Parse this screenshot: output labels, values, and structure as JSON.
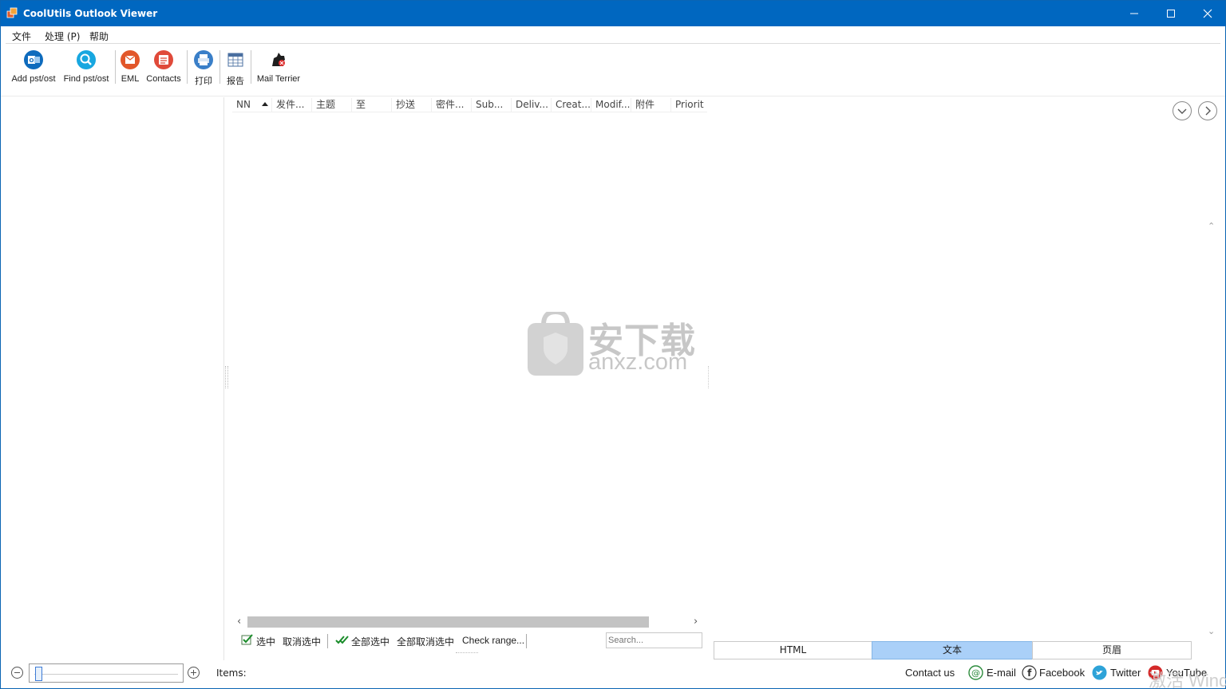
{
  "window": {
    "title": "CoolUtils Outlook Viewer"
  },
  "menu": {
    "items": [
      "文件",
      "处理 (P)",
      "帮助"
    ]
  },
  "toolbar": {
    "buttons": [
      {
        "label": "Add pst/ost",
        "icon": "outlook-icon"
      },
      {
        "label": "Find pst/ost",
        "icon": "search-icon"
      },
      {
        "label": "EML",
        "icon": "eml-icon"
      },
      {
        "label": "Contacts",
        "icon": "contacts-icon"
      },
      {
        "label": "打印",
        "icon": "print-icon"
      },
      {
        "label": "报告",
        "icon": "report-icon"
      },
      {
        "label": "Mail Terrier",
        "icon": "terrier-icon"
      }
    ]
  },
  "grid": {
    "columns": [
      "NN",
      "发件...",
      "主题",
      "至",
      "抄送",
      "密件...",
      "Sub...",
      "Deliv...",
      "Creat...",
      "Modif...",
      "附件",
      "Priorit"
    ]
  },
  "checkbar": {
    "select": "选中",
    "deselect": "取消选中",
    "select_all": "全部选中",
    "deselect_all": "全部取消选中",
    "check_range": "Check range..."
  },
  "search": {
    "placeholder": "Search..."
  },
  "preview_tabs": [
    "HTML",
    "文本",
    "页眉"
  ],
  "preview_active_tab": "文本",
  "status": {
    "items_label": "Items:",
    "contact_us": "Contact us",
    "email": "E-mail",
    "facebook": "Facebook",
    "twitter": "Twitter",
    "youtube": "YouTube"
  },
  "watermark": {
    "text": "安下载",
    "sub": "anxz.com"
  },
  "activation_text": "激活 Wind",
  "colors": {
    "titlebar": "#0067c0",
    "active_tab": "#aad0f8"
  }
}
